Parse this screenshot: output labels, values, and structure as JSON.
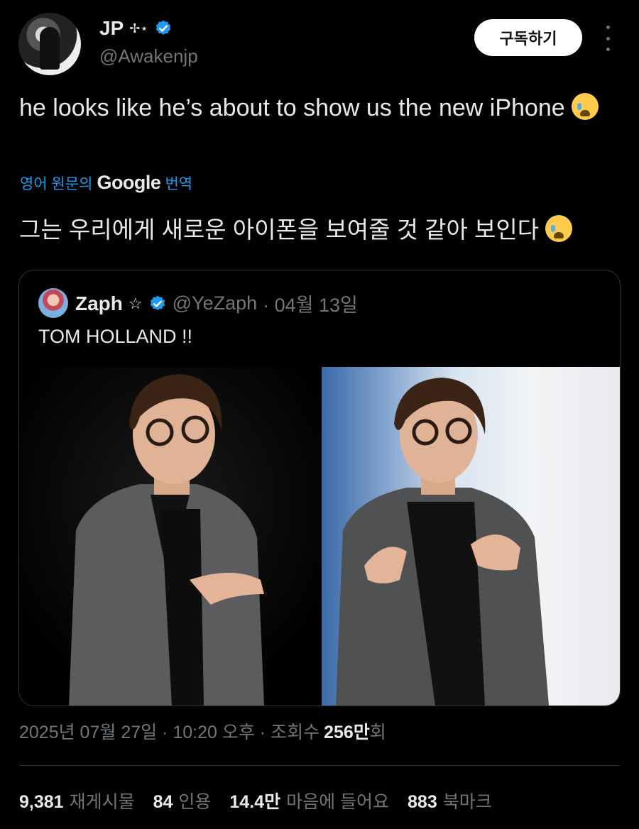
{
  "author": {
    "name": "JP",
    "name_decoration": "✢⋆",
    "handle": "@Awakenjp",
    "verified": true
  },
  "subscribe_label": "구독하기",
  "tweet": {
    "text": "he looks like he’s about to show us the new iPhone",
    "emoji": "loudly-crying-face",
    "translate": {
      "prefix": "영어 원문의",
      "brand": "Google",
      "suffix": "번역"
    },
    "translated_text": "그는 우리에게 새로운 아이폰을 보여줄 것 같아 보인다"
  },
  "quoted": {
    "name": "Zaph",
    "star": "☆",
    "handle": "@YeZaph",
    "date": "· 04월 13일",
    "text": "TOM HOLLAND !!",
    "images": [
      "photo-left-stage-dark",
      "photo-right-stage-light"
    ]
  },
  "meta": {
    "timestamp": "2025년 07월 27일 · 10:20 오후 · 조회수",
    "views_number": "256만",
    "views_suffix": "회"
  },
  "stats": [
    {
      "value": "9,381",
      "label": "재게시물"
    },
    {
      "value": "84",
      "label": "인용"
    },
    {
      "value": "14.4만",
      "label": "마음에 들어요"
    },
    {
      "value": "883",
      "label": "북마크"
    }
  ],
  "colors": {
    "background": "#000000",
    "text": "#e7e9ea",
    "secondary": "#71767b",
    "link": "#1d9bf0",
    "verified": "#1d9bf0",
    "border": "#2f3336"
  }
}
